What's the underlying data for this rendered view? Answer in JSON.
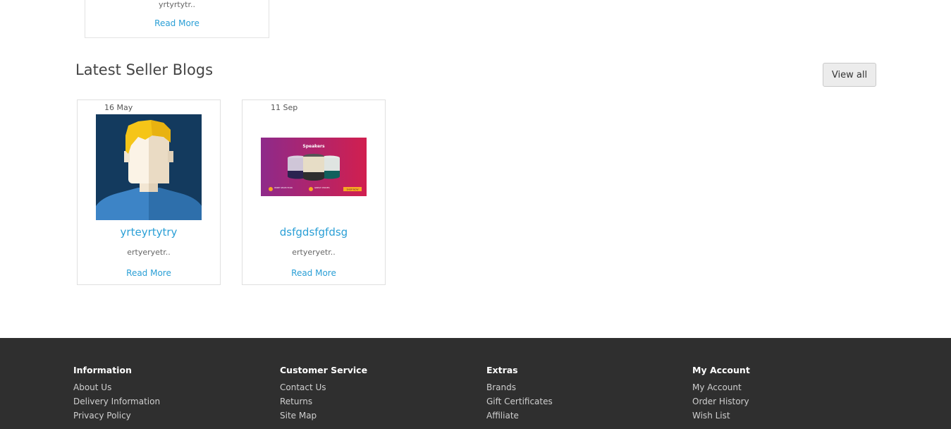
{
  "top_card": {
    "excerpt": "yrtyrtytr..",
    "read_more": "Read More"
  },
  "section": {
    "title": "Latest Seller Blogs",
    "view_all": "View all"
  },
  "blogs": [
    {
      "date": "16 May",
      "title": "yrteyrtytry",
      "excerpt": "ertyeryetr..",
      "read_more": "Read More",
      "image": "avatar-illustration"
    },
    {
      "date": "11 Sep",
      "title": "dsfgdsfgfdsg",
      "excerpt": "ertyeryetr..",
      "read_more": "Read More",
      "image": "speakers-banner",
      "banner": {
        "heading": "Speakers",
        "badge_1": "WIDE SELECTION",
        "badge_2": "GREAT PRICES",
        "cta": "SHOP NOW"
      }
    }
  ],
  "footer": {
    "columns": [
      {
        "heading": "Information",
        "links": [
          "About Us",
          "Delivery Information",
          "Privacy Policy"
        ]
      },
      {
        "heading": "Customer Service",
        "links": [
          "Contact Us",
          "Returns",
          "Site Map"
        ]
      },
      {
        "heading": "Extras",
        "links": [
          "Brands",
          "Gift Certificates",
          "Affiliate"
        ]
      },
      {
        "heading": "My Account",
        "links": [
          "My Account",
          "Order History",
          "Wish List"
        ]
      }
    ]
  },
  "colors": {
    "link": "#2a9fd6",
    "footer_bg": "#2f2f2f",
    "avatar_bg": "#133a5e",
    "banner_bg": "#b5205a"
  }
}
